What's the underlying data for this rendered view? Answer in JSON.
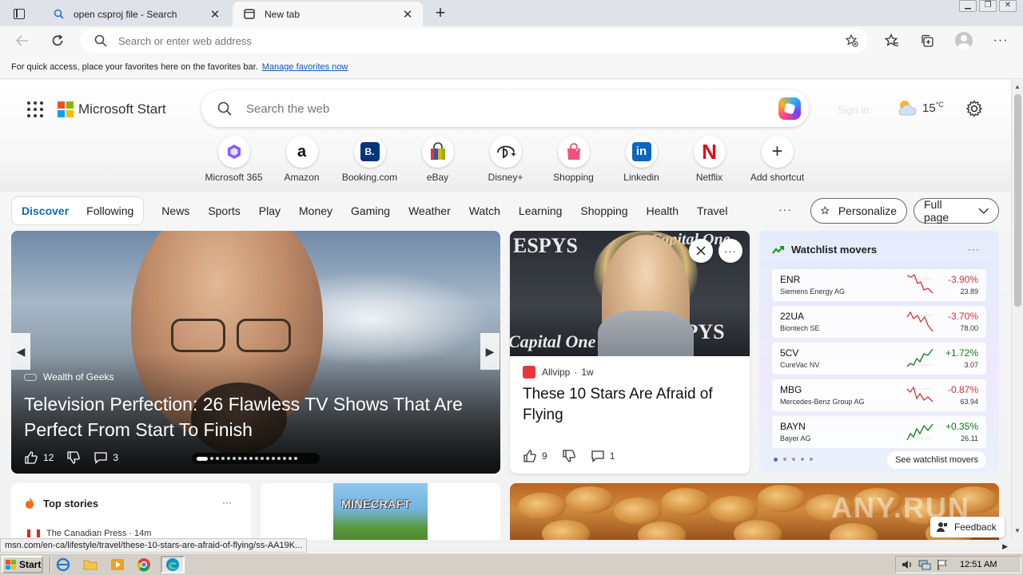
{
  "browser": {
    "tabs": [
      {
        "title": "open csproj file - Search",
        "active": false,
        "icon": "search-icon"
      },
      {
        "title": "New tab",
        "active": true,
        "icon": "newtab-icon"
      }
    ],
    "new_tab_symbol": "+",
    "close_symbol": "✕",
    "window_controls": [
      "▁",
      "❐",
      "✕"
    ],
    "address_placeholder": "Search or enter web address",
    "favbar_text": "For quick access, place your favorites here on the favorites bar.",
    "favbar_link": "Manage favorites now"
  },
  "start_page": {
    "brand": "Microsoft Start",
    "search_placeholder": "Search the web",
    "signin": "Sign in",
    "weather": {
      "temp": "15",
      "unit": "°C"
    },
    "shortcuts": [
      {
        "label": "Microsoft 365",
        "glyph": "",
        "color": "#7b4fd8"
      },
      {
        "label": "Amazon",
        "glyph": "a",
        "color": "#111111"
      },
      {
        "label": "Booking.com",
        "glyph": "B.",
        "color": "#003580"
      },
      {
        "label": "eBay",
        "glyph": "",
        "color": "#e53238"
      },
      {
        "label": "Disney+",
        "glyph": "",
        "color": "#222222"
      },
      {
        "label": "Shopping",
        "glyph": "",
        "color": "#e8365d"
      },
      {
        "label": "Linkedin",
        "glyph": "in",
        "color": "#0a66c2"
      },
      {
        "label": "Netflix",
        "glyph": "N",
        "color": "#e50914"
      },
      {
        "label": "Add shortcut",
        "glyph": "+",
        "color": "#333333"
      }
    ],
    "feed_tabs": {
      "discover": "Discover",
      "following": "Following"
    },
    "nav": [
      "News",
      "Sports",
      "Play",
      "Money",
      "Gaming",
      "Weather",
      "Watch",
      "Learning",
      "Shopping",
      "Health",
      "Travel"
    ],
    "nav_more": "···",
    "personalize": "Personalize",
    "full_page": "Full page"
  },
  "hero": {
    "source": "Wealth of Geeks",
    "title": "Television Perfection: 26 Flawless TV Shows That Are Perfect From Start To Finish",
    "likes": "12",
    "comments": "3",
    "slide_index": 1,
    "slide_count": 17
  },
  "news": {
    "publisher": "Allvipp",
    "age": "1w",
    "title": "These 10 Stars Are Afraid of Flying",
    "likes": "9",
    "comments": "1",
    "image_text_left": "ESPYS",
    "image_text_right": "Capital One",
    "image_text_bottom": "Capital One",
    "image_text_side": "SPYS"
  },
  "watchlist": {
    "title": "Watchlist movers",
    "more": "···",
    "see_all": "See watchlist movers",
    "stocks": [
      {
        "symbol": "ENR",
        "name": "Siemens Energy AG",
        "change": "-3.90%",
        "price": "23.89",
        "color": "#d13438"
      },
      {
        "symbol": "22UA",
        "name": "Biontech SE",
        "change": "-3.70%",
        "price": "78.00",
        "color": "#d13438"
      },
      {
        "symbol": "5CV",
        "name": "CureVac NV",
        "change": "+1.72%",
        "price": "3.07",
        "color": "#107c10"
      },
      {
        "symbol": "MBG",
        "name": "Mercedes-Benz Group AG",
        "change": "-0.87%",
        "price": "63.94",
        "color": "#d13438"
      },
      {
        "symbol": "BAYN",
        "name": "Bayer AG",
        "change": "+0.35%",
        "price": "26.11",
        "color": "#107c10"
      }
    ]
  },
  "top_stories": {
    "title": "Top stories",
    "more": "···",
    "first_item": "The Canadian Press · 14m"
  },
  "game_card": {
    "wordmark": "MINECRAFT"
  },
  "feedback": "Feedback",
  "watermark": "ANY.RUN",
  "status_url": "msn.com/en-ca/lifestyle/travel/these-10-stars-are-afraid-of-flying/ss-AA19K...",
  "taskbar": {
    "start": "Start",
    "clock": "12:51 AM"
  }
}
